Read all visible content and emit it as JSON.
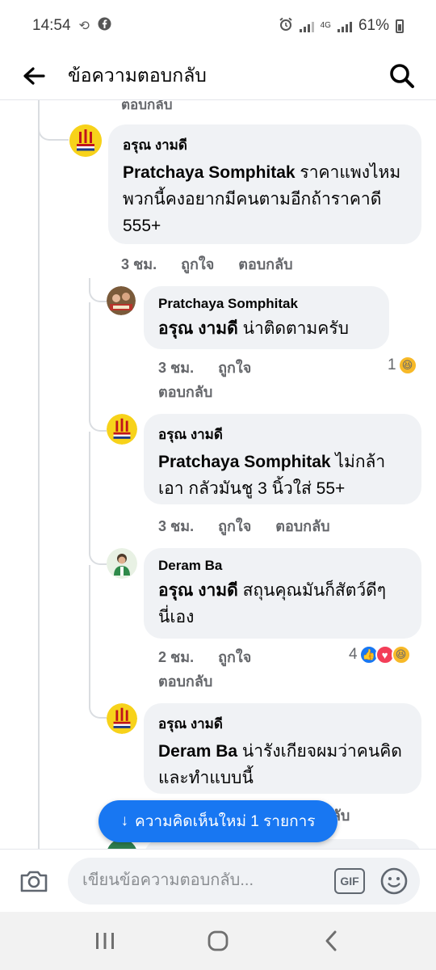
{
  "status_bar": {
    "time": "14:54",
    "network": "4G",
    "battery": "61%"
  },
  "header": {
    "title": "ข้อความตอบกลับ"
  },
  "partial_top_text": "ตอบกลับ",
  "comments": [
    {
      "author": "อรุณ งามดี",
      "mention": "Pratchaya Somphitak",
      "text": " ราคาแพงไหม พวกนี้คงอยากมีคนตามอีกถ้าราคาดี 555+",
      "time": "3 ชม.",
      "like": "ถูกใจ",
      "reply": "ตอบกลับ"
    },
    {
      "author": "Pratchaya Somphitak",
      "mention": "อรุณ งามดี",
      "text": " น่าติดตามครับ",
      "time": "3 ชม.",
      "like": "ถูกใจ",
      "reply": "ตอบกลับ",
      "reaction_count": "1"
    },
    {
      "author": "อรุณ งามดี",
      "mention": "Pratchaya Somphitak",
      "text": " ไม่กล้าเอา กลัวมันชู 3 นิ้วใส่ 55+",
      "time": "3 ชม.",
      "like": "ถูกใจ",
      "reply": "ตอบกลับ"
    },
    {
      "author": "Deram Ba",
      "mention": "อรุณ งามดี",
      "text": " สถุนคุณมันก็สัตว์ดีๆนี่เอง",
      "time": "2 ชม.",
      "like": "ถูกใจ",
      "reply": "ตอบกลับ",
      "reaction_count": "4"
    },
    {
      "author": "อรุณ งามดี",
      "mention": "Deram Ba",
      "text": " น่ารังเกียจผมว่าคนคิดและทำแบบนี้",
      "partial_reply": "ตอบกลับ"
    }
  ],
  "new_comments_pill": {
    "arrow": "↓",
    "label": "ความคิดเห็นใหม่ 1 รายการ"
  },
  "composer": {
    "placeholder": "เขียนข้อความตอบกลับ...",
    "gif_label": "GIF"
  },
  "colors": {
    "accent": "#1877f2",
    "bubble": "#f0f2f5",
    "meta_text": "#65676b"
  }
}
